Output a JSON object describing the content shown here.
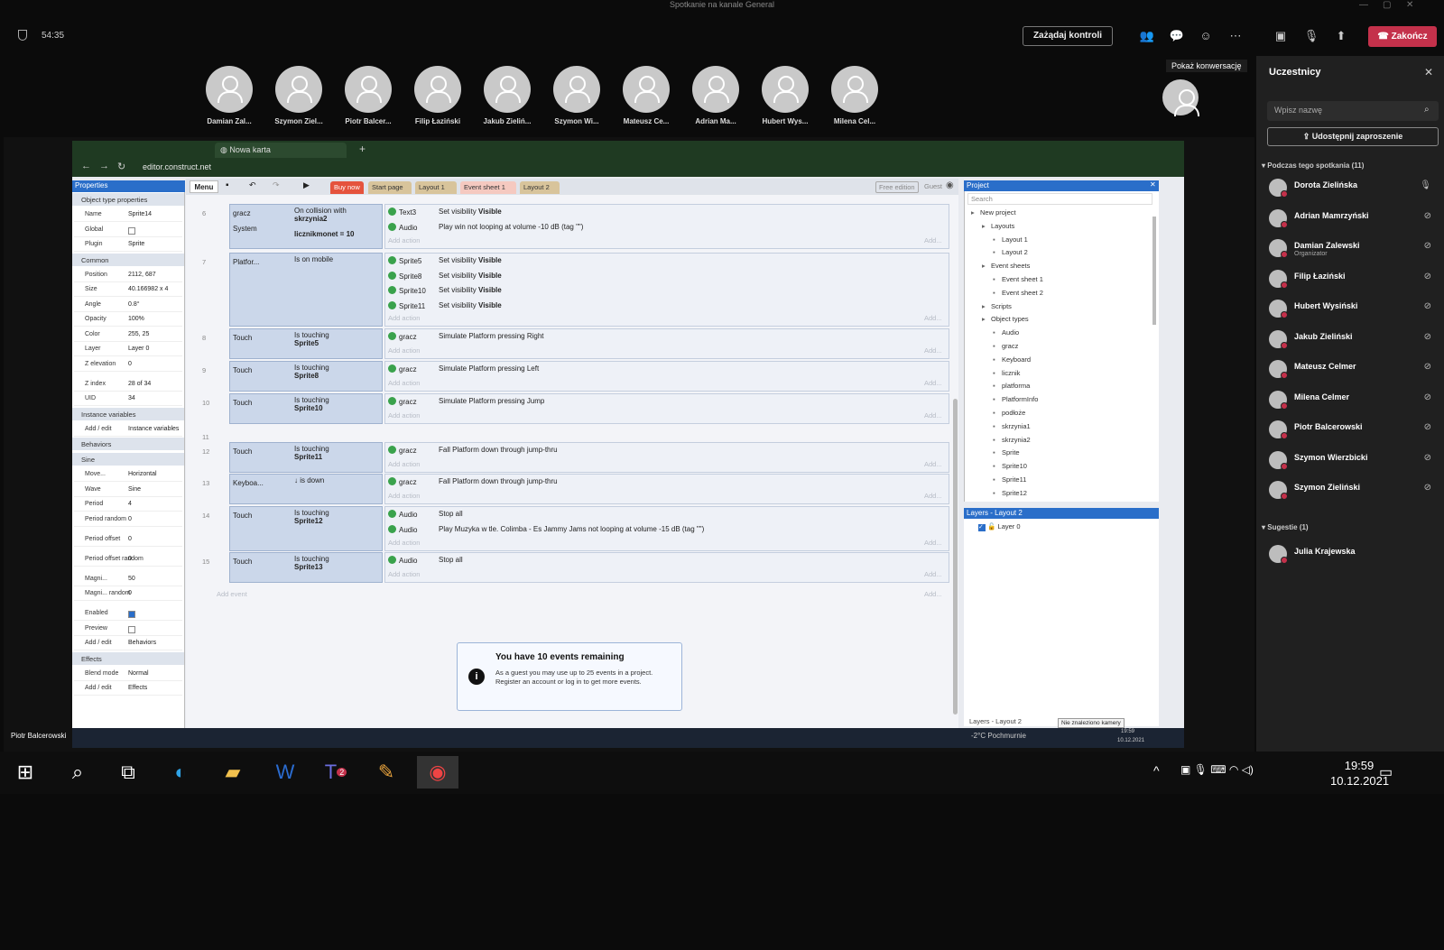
{
  "window": {
    "title": "Spotkanie na kanale General"
  },
  "meeting": {
    "timer": "54:35",
    "request_control": "Zażądaj kontroli",
    "end": "Zakończ",
    "tooltip": "Pokaż konwersację"
  },
  "participants_strip": [
    "Damian Zal...",
    "Szymon Ziel...",
    "Piotr Balcer...",
    "Filip Łaziński",
    "Jakub Zieliń...",
    "Szymon Wi...",
    "Mateusz Ce...",
    "Adrian Ma...",
    "Hubert Wys...",
    "Milena Cel..."
  ],
  "panel": {
    "title": "Uczestnicy",
    "search_placeholder": "Wpisz nazwę",
    "invite": "Udostępnij zaproszenie",
    "section_in_meeting": "Podczas tego spotkania (11)",
    "section_suggestions": "Sugestie (1)",
    "people": [
      {
        "name": "Dorota Zielińska",
        "sub": "",
        "mic": "on"
      },
      {
        "name": "Adrian Mamrzyński",
        "sub": "",
        "mic": "off"
      },
      {
        "name": "Damian Zalewski",
        "sub": "Organizator",
        "mic": "off"
      },
      {
        "name": "Filip Łaziński",
        "sub": "",
        "mic": "off"
      },
      {
        "name": "Hubert Wysiński",
        "sub": "",
        "mic": "off"
      },
      {
        "name": "Jakub Zieliński",
        "sub": "",
        "mic": "off"
      },
      {
        "name": "Mateusz Celmer",
        "sub": "",
        "mic": "off"
      },
      {
        "name": "Milena Celmer",
        "sub": "",
        "mic": "off"
      },
      {
        "name": "Piotr Balcerowski",
        "sub": "",
        "mic": "off"
      },
      {
        "name": "Szymon Wierzbicki",
        "sub": "",
        "mic": "off"
      },
      {
        "name": "Szymon Zieliński",
        "sub": "",
        "mic": "off"
      }
    ],
    "suggestion": "Julia Krajewska"
  },
  "presenter": "Piotr Balcerowski",
  "browser": {
    "tab": "Nowa karta",
    "url": "editor.construct.net"
  },
  "editor": {
    "menu": "Menu",
    "buy": "Buy now",
    "free": "Free edition",
    "guest": "Guest",
    "tabs": [
      "Start page",
      "Layout 1",
      "Event sheet 1",
      "Layout 2"
    ],
    "properties_title": "Properties",
    "props": [
      {
        "cat": "Object type properties"
      },
      {
        "k": "Name",
        "v": "Sprite14"
      },
      {
        "k": "Global",
        "v": ""
      },
      {
        "k": "Plugin",
        "v": "Sprite"
      },
      {
        "cat": "Common"
      },
      {
        "k": "Position",
        "v": "2112, 687"
      },
      {
        "k": "Size",
        "v": "40.166982 x 4"
      },
      {
        "k": "Angle",
        "v": "0.8°"
      },
      {
        "k": "Opacity",
        "v": "100%"
      },
      {
        "k": "Color",
        "v": "255, 25"
      },
      {
        "k": "Layer",
        "v": "Layer 0"
      },
      {
        "k": "Z elevation",
        "v": "0"
      },
      {
        "k": "Z index",
        "v": "28 of 34"
      },
      {
        "k": "UID",
        "v": "34"
      },
      {
        "cat": "Instance variables"
      },
      {
        "k": "Add / edit",
        "v": "Instance variables"
      },
      {
        "cat": "Behaviors"
      },
      {
        "cat": "Sine"
      },
      {
        "k": "Move...",
        "v": "Horizontal"
      },
      {
        "k": "Wave",
        "v": "Sine"
      },
      {
        "k": "Period",
        "v": "4"
      },
      {
        "k": "Period random",
        "v": "0"
      },
      {
        "k": "Period offset",
        "v": "0"
      },
      {
        "k": "Period offset random",
        "v": "0"
      },
      {
        "k": "Magni...",
        "v": "50"
      },
      {
        "k": "Magni... random",
        "v": "0"
      },
      {
        "k": "Enabled",
        "v": ""
      },
      {
        "k": "Preview",
        "v": ""
      },
      {
        "k": "Add / edit",
        "v": "Behaviors"
      },
      {
        "cat": "Effects"
      },
      {
        "k": "Blend mode",
        "v": "Normal"
      },
      {
        "k": "Add / edit",
        "v": "Effects"
      }
    ],
    "events": [
      {
        "n": "6",
        "conds": [
          {
            "obj": "gracz",
            "txt": "On collision with",
            "bold": "skrzynia2"
          },
          {
            "obj": "System",
            "txt": "",
            "bold": "licznikmonet = 10"
          }
        ],
        "acts": [
          {
            "obj": "Text3",
            "txt": "Set visibility ",
            "bold": "Visible"
          },
          {
            "obj": "Audio",
            "txt": "Play win not looping at volume -10 dB (tag \"\")",
            "bold": ""
          }
        ]
      },
      {
        "n": "7",
        "conds": [
          {
            "obj": "Platfor...",
            "txt": "Is on mobile",
            "bold": ""
          }
        ],
        "acts": [
          {
            "obj": "Sprite5",
            "txt": "Set visibility ",
            "bold": "Visible"
          },
          {
            "obj": "Sprite8",
            "txt": "Set visibility ",
            "bold": "Visible"
          },
          {
            "obj": "Sprite10",
            "txt": "Set visibility ",
            "bold": "Visible"
          },
          {
            "obj": "Sprite11",
            "txt": "Set visibility ",
            "bold": "Visible"
          }
        ]
      },
      {
        "n": "8",
        "conds": [
          {
            "obj": "Touch",
            "txt": "Is touching",
            "bold": "Sprite5"
          }
        ],
        "acts": [
          {
            "obj": "gracz",
            "txt": "Simulate Platform pressing Right",
            "bold": ""
          }
        ]
      },
      {
        "n": "9",
        "conds": [
          {
            "obj": "Touch",
            "txt": "Is touching",
            "bold": "Sprite8"
          }
        ],
        "acts": [
          {
            "obj": "gracz",
            "txt": "Simulate Platform pressing Left",
            "bold": ""
          }
        ]
      },
      {
        "n": "10",
        "conds": [
          {
            "obj": "Touch",
            "txt": "Is touching",
            "bold": "Sprite10"
          }
        ],
        "acts": [
          {
            "obj": "gracz",
            "txt": "Simulate Platform pressing Jump",
            "bold": ""
          }
        ]
      },
      {
        "n": "11",
        "conds": [],
        "acts": []
      },
      {
        "n": "12",
        "conds": [
          {
            "obj": "Touch",
            "txt": "Is touching",
            "bold": "Sprite11"
          }
        ],
        "acts": [
          {
            "obj": "gracz",
            "txt": "Fall Platform down through jump-thru",
            "bold": ""
          }
        ]
      },
      {
        "n": "13",
        "conds": [
          {
            "obj": "Keyboa...",
            "txt": "↓ is down",
            "bold": ""
          }
        ],
        "acts": [
          {
            "obj": "gracz",
            "txt": "Fall Platform down through jump-thru",
            "bold": ""
          }
        ]
      },
      {
        "n": "14",
        "conds": [
          {
            "obj": "Touch",
            "txt": "Is touching",
            "bold": "Sprite12"
          }
        ],
        "acts": [
          {
            "obj": "Audio",
            "txt": "Stop all",
            "bold": ""
          },
          {
            "obj": "Audio",
            "txt": "Play Muzyka w tle. Colimba - Es Jammy Jams not looping at volume -15 dB (tag \"\")",
            "bold": ""
          }
        ]
      },
      {
        "n": "15",
        "conds": [
          {
            "obj": "Touch",
            "txt": "Is touching",
            "bold": "Sprite13"
          }
        ],
        "acts": [
          {
            "obj": "Audio",
            "txt": "Stop all",
            "bold": ""
          }
        ]
      }
    ],
    "add_action": "Add action",
    "add_event": "Add event",
    "add": "Add...",
    "notice": {
      "title": "You have 10 events remaining",
      "body": "As a guest you may use up to 25 events in a project. Register an account or log in to get more events."
    },
    "project_title": "Project",
    "project_search": "Search",
    "tree": [
      "New project",
      "Layouts",
      "Layout 1",
      "Layout 2",
      "Event sheets",
      "Event sheet 1",
      "Event sheet 2",
      "Scripts",
      "Object types",
      "Audio",
      "gracz",
      "Keyboard",
      "licznik",
      "platforma",
      "PlatformInfo",
      "podłoże",
      "skrzynia1",
      "skrzynia2",
      "Sprite",
      "Sprite10",
      "Sprite11",
      "Sprite12"
    ],
    "layers_title": "Layers - Layout 2",
    "layer0": "Layer 0",
    "layers_tab": "Layers - Layout 2",
    "tooltip": "Nie znaleziono kamery"
  },
  "inner_taskbar": {
    "weather": "-2°C Pochmurnie",
    "time": "19:59",
    "date": "10.12.2021"
  },
  "taskbar": {
    "time": "19:59",
    "date": "10.12.2021",
    "teams_badge": "2"
  }
}
